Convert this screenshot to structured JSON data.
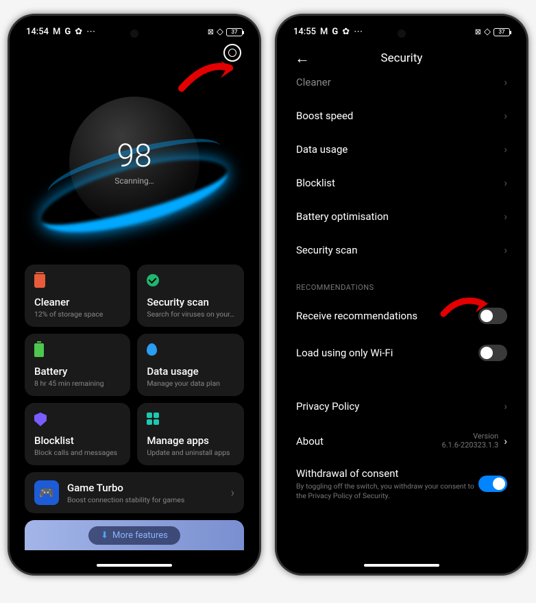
{
  "left": {
    "status": {
      "time": "14:54",
      "battery": "37"
    },
    "score": "98",
    "score_status": "Scanning…",
    "tiles": [
      {
        "title": "Cleaner",
        "sub": "12% of storage space"
      },
      {
        "title": "Security scan",
        "sub": "Search for viruses on your…"
      },
      {
        "title": "Battery",
        "sub": "8 hr 45 min  remaining"
      },
      {
        "title": "Data usage",
        "sub": "Manage your data plan"
      },
      {
        "title": "Blocklist",
        "sub": "Block calls and messages"
      },
      {
        "title": "Manage apps",
        "sub": "Update and uninstall apps"
      }
    ],
    "game_turbo": {
      "title": "Game Turbo",
      "sub": "Boost connection stability for games"
    },
    "more_features": "More features"
  },
  "right": {
    "status": {
      "time": "14:55",
      "battery": "37"
    },
    "page_title": "Security",
    "items_top": [
      "Cleaner",
      "Boost speed",
      "Data usage",
      "Blocklist",
      "Battery optimisation",
      "Security scan"
    ],
    "section_recs": "RECOMMENDATIONS",
    "toggle1": "Receive recommendations",
    "toggle2": "Load using only Wi-Fi",
    "privacy": "Privacy Policy",
    "about": {
      "label": "About",
      "version_label": "Version",
      "version": "6.1.6-220323.1.3"
    },
    "withdraw": {
      "label": "Withdrawal of consent",
      "sub": "By toggling off the switch, you withdraw your consent to the Privacy Policy of Security."
    }
  }
}
